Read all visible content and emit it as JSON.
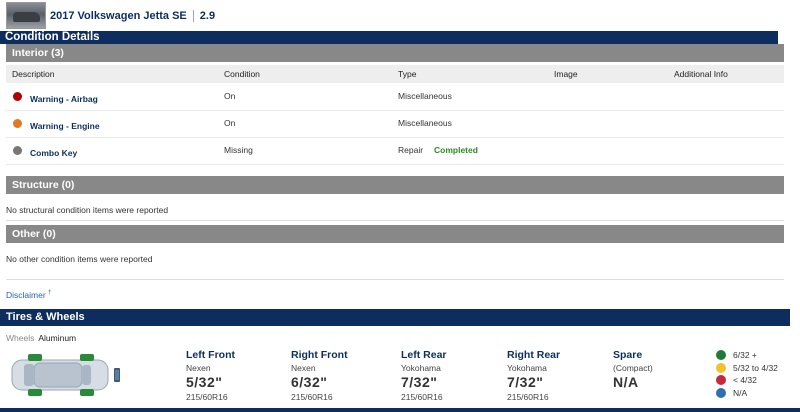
{
  "vehicle": {
    "title": "2017 Volkswagen Jetta SE",
    "grade": "2.9"
  },
  "condition_details": {
    "header": "Condition Details",
    "interior": {
      "header": "Interior (3)",
      "columns": [
        "Description",
        "Condition",
        "Type",
        "Image",
        "Additional Info"
      ],
      "rows": [
        {
          "description": "Warning - Airbag",
          "condition": "On",
          "type": "Miscellaneous",
          "status": "",
          "dot_color": "#b00000"
        },
        {
          "description": "Warning - Engine",
          "condition": "On",
          "type": "Miscellaneous",
          "status": "",
          "dot_color": "#e07b22"
        },
        {
          "description": "Combo Key",
          "condition": "Missing",
          "type": "Repair",
          "status": "Completed",
          "dot_color": "#777777"
        }
      ]
    },
    "structure": {
      "header": "Structure (0)",
      "message": "No structural condition items were reported"
    },
    "other": {
      "header": "Other (0)",
      "message": "No other condition items were reported"
    },
    "disclaimer": "Disclaimer",
    "disclaimer_mark": "†"
  },
  "tires_wheels": {
    "header": "Tires & Wheels",
    "wheels_label": "Wheels",
    "wheels_value": "Aluminum",
    "tires": [
      {
        "position": "Left Front",
        "brand": "Nexen",
        "tread": "5/32\"",
        "size": "215/60R16"
      },
      {
        "position": "Right Front",
        "brand": "Nexen",
        "tread": "6/32\"",
        "size": "215/60R16"
      },
      {
        "position": "Left Rear",
        "brand": "Yokohama",
        "tread": "7/32\"",
        "size": "215/60R16"
      },
      {
        "position": "Right Rear",
        "brand": "Yokohama",
        "tread": "7/32\"",
        "size": "215/60R16"
      },
      {
        "position": "Spare",
        "brand": "(Compact)",
        "tread": "N/A",
        "size": ""
      }
    ],
    "legend": [
      {
        "label": "6/32 +",
        "color": "#1e7a35"
      },
      {
        "label": "5/32 to 4/32",
        "color": "#f2c12e"
      },
      {
        "label": "< 4/32",
        "color": "#c8283c"
      },
      {
        "label": "N/A",
        "color": "#2f6fb0"
      }
    ]
  },
  "colors": {
    "navy": "#0d2d5e",
    "panel_gray": "#888888",
    "completed_green": "#2e8b22",
    "link_blue": "#2962b3"
  }
}
